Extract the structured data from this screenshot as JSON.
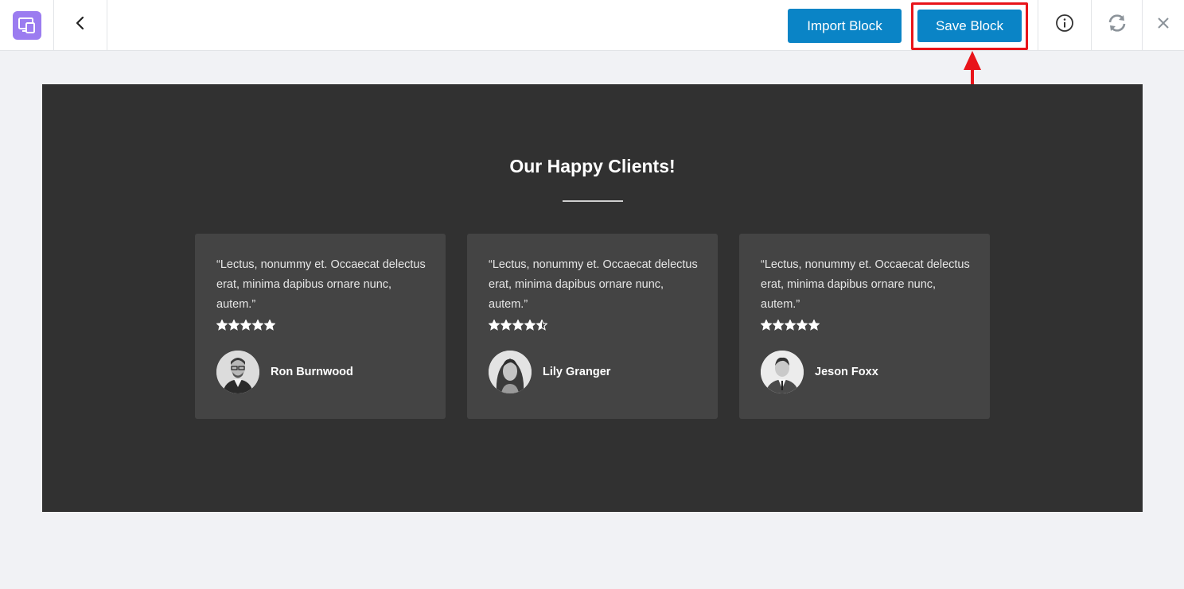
{
  "toolbar": {
    "import_label": "Import Block",
    "save_label": "Save Block",
    "icons": {
      "logo": "responsive-devices-icon",
      "back": "chevron-left-icon",
      "info": "info-icon",
      "sync": "refresh-icon",
      "close": "close-icon"
    }
  },
  "colors": {
    "accent": "#0a84c6",
    "logo": "#9b7cf0",
    "highlight": "#e8141a",
    "section_bg": "#313131",
    "card_bg": "#444444"
  },
  "section": {
    "heading": "Our Happy Clients!",
    "testimonials": [
      {
        "quote": "“Lectus, nonummy et. Occaecat delectus erat, minima dapibus ornare nunc, autem.”",
        "rating": 5,
        "name": "Ron Burnwood"
      },
      {
        "quote": "“Lectus, nonummy et. Occaecat delectus erat, minima dapibus ornare nunc, autem.”",
        "rating": 4.5,
        "name": "Lily Granger"
      },
      {
        "quote": "“Lectus, nonummy et. Occaecat delectus erat, minima dapibus ornare nunc, autem.”",
        "rating": 5,
        "name": "Jeson Foxx"
      }
    ]
  }
}
